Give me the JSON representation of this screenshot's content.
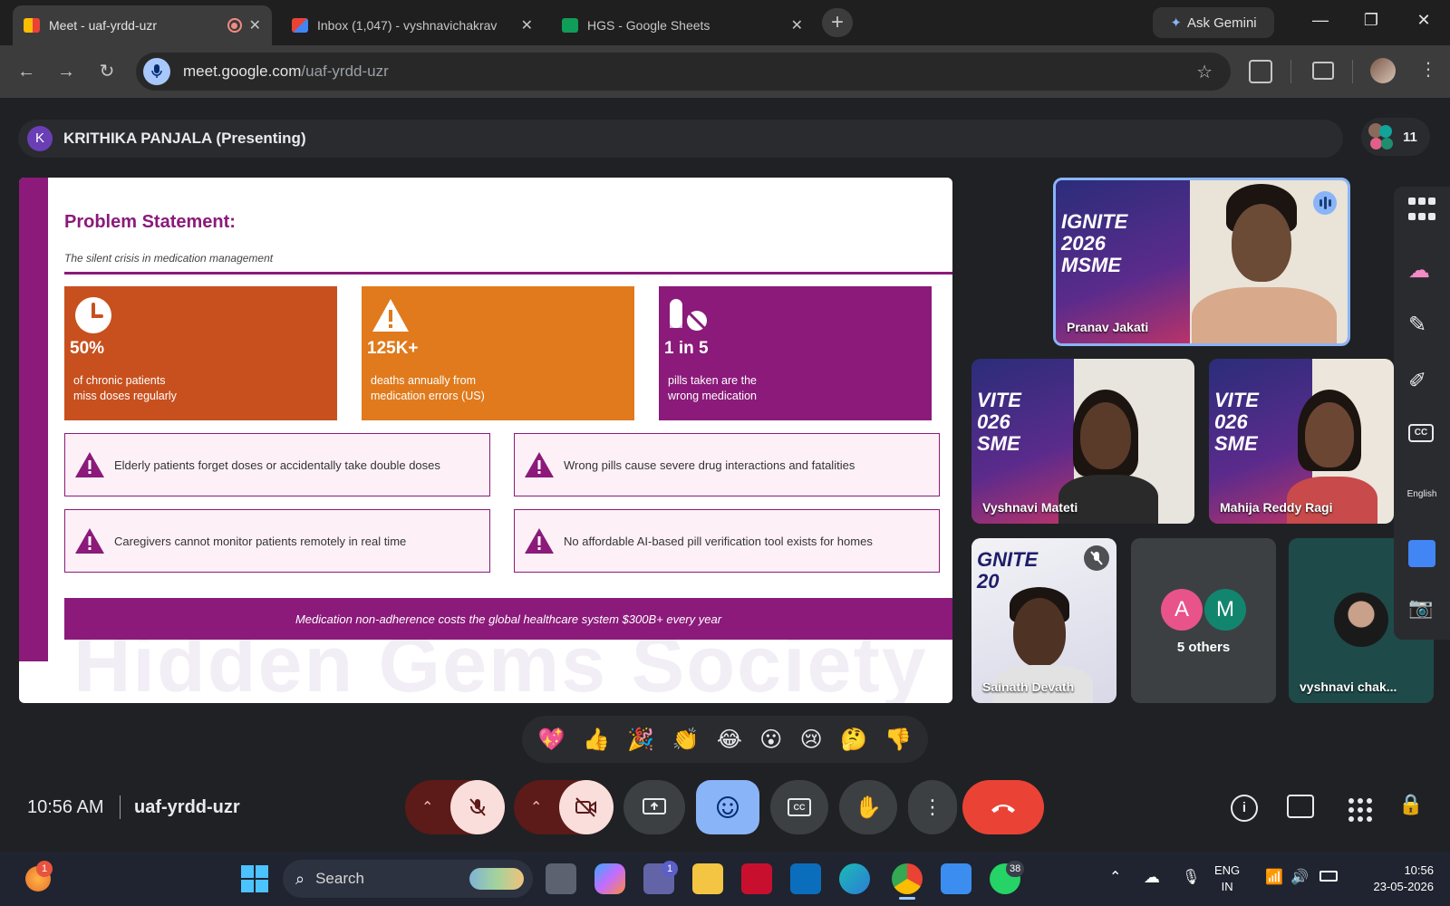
{
  "browser": {
    "tabs": [
      {
        "title": "Meet - uaf-yrdd-uzr",
        "active": true
      },
      {
        "title": "Inbox (1,047) - vyshnavichakrav",
        "active": false
      },
      {
        "title": "HGS - Google Sheets",
        "active": false
      }
    ],
    "ask_gemini": "Ask Gemini",
    "url_host": "meet.google.com",
    "url_path": "/uaf-yrdd-uzr"
  },
  "meet": {
    "presenter_initial": "K",
    "presenter_label": "KRITHIKA PANJALA (Presenting)",
    "participant_count": "11",
    "slide": {
      "title": "Problem Statement:",
      "subtitle": "The silent crisis in medication management",
      "stats": [
        {
          "value": "50%",
          "desc": "of chronic patients\nmiss doses regularly",
          "color": "#c8501e",
          "icon": "clock-icon"
        },
        {
          "value": "125K+",
          "desc": "deaths annually from\nmedication errors (US)",
          "color": "#e07a1c",
          "icon": "warning-icon"
        },
        {
          "value": "1 in 5",
          "desc": "pills taken are the\nwrong medication",
          "color": "#8b1a7a",
          "icon": "pills-icon"
        }
      ],
      "warnings": [
        "Elderly patients forget doses or accidentally take double doses",
        "Wrong pills cause severe drug interactions and fatalities",
        "Caregivers cannot monitor patients remotely in real time",
        "No affordable AI-based pill verification tool exists for homes"
      ],
      "banner": "Medication non-adherence costs the global healthcare system $300B+ every year",
      "watermark": "Hidden Gems Society"
    },
    "tiles": [
      {
        "name": "Pranav Jakati",
        "poster_text": "IGNITE\n2026\nMSME"
      },
      {
        "name": "Vyshnavi Mateti",
        "poster_text": "VITE\n026\nSME"
      },
      {
        "name": "Mahija Reddy Ragi",
        "poster_text": "VITE\n026\nSME"
      },
      {
        "name": "Sainath Devath",
        "poster_text": "GNITE\n20"
      }
    ],
    "others": {
      "label": "5 others",
      "avatars": [
        "A",
        "M"
      ]
    },
    "vyshnavi_tile": "vyshnavi chak...",
    "side_panel_language": "English",
    "reactions": [
      "💖",
      "👍",
      "🎉",
      "👏",
      "😂",
      "😮",
      "😢",
      "🤔",
      "👎"
    ],
    "clock": "10:56 AM",
    "meeting_code": "uaf-yrdd-uzr"
  },
  "taskbar": {
    "search_placeholder": "Search",
    "teams_badge": "1",
    "whatsapp_badge": "38",
    "copilot_badge": "1",
    "language_line1": "ENG",
    "language_line2": "IN",
    "time": "10:56",
    "date": "23-05-2026"
  }
}
